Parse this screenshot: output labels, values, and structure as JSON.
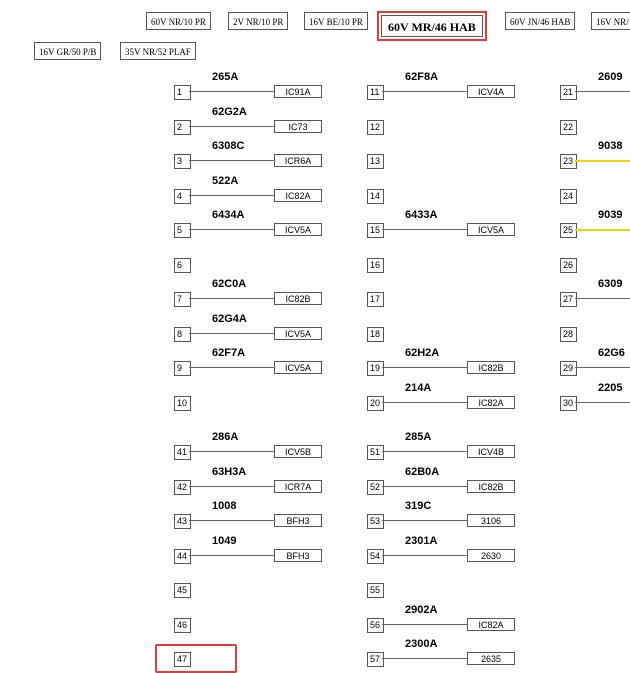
{
  "tabs": [
    {
      "label": "60V NR/10 PR",
      "active": false
    },
    {
      "label": "2V NR/10 PR",
      "active": false
    },
    {
      "label": "16V BE/10 PR",
      "active": false
    },
    {
      "label": "60V MR/46 HAB",
      "active": true
    },
    {
      "label": "60V JN/46 HAB",
      "active": false
    },
    {
      "label": "16V NR/",
      "active": false
    },
    {
      "label": "16V GR/50 P/B",
      "active": false
    },
    {
      "label": "35V NR/52 PLAF",
      "active": false
    }
  ],
  "colors": {
    "accent": "#e53935",
    "yellow_wire": "#f2d500"
  },
  "columns": [
    {
      "id": "col1",
      "slots": [
        {
          "n": "1",
          "circuit": "265A",
          "dest": "IC91A"
        },
        {
          "n": "2",
          "circuit": "62G2A",
          "dest": "IC73"
        },
        {
          "n": "3",
          "circuit": "6308C",
          "dest": "ICR6A"
        },
        {
          "n": "4",
          "circuit": "522A",
          "dest": "IC82A"
        },
        {
          "n": "5",
          "circuit": "6434A",
          "dest": "ICV5A"
        },
        {
          "n": "6",
          "circuit": "",
          "dest": ""
        },
        {
          "n": "7",
          "circuit": "62C0A",
          "dest": "IC82B"
        },
        {
          "n": "8",
          "circuit": "62G4A",
          "dest": "ICV5A"
        },
        {
          "n": "9",
          "circuit": "62F7A",
          "dest": "ICV5A"
        },
        {
          "n": "10",
          "circuit": "",
          "dest": ""
        }
      ]
    },
    {
      "id": "col2",
      "slots": [
        {
          "n": "11",
          "circuit": "62F8A",
          "dest": "ICV4A"
        },
        {
          "n": "12",
          "circuit": "",
          "dest": ""
        },
        {
          "n": "13",
          "circuit": "",
          "dest": ""
        },
        {
          "n": "14",
          "circuit": "",
          "dest": ""
        },
        {
          "n": "15",
          "circuit": "6433A",
          "dest": "ICV5A"
        },
        {
          "n": "16",
          "circuit": "",
          "dest": ""
        },
        {
          "n": "17",
          "circuit": "",
          "dest": ""
        },
        {
          "n": "18",
          "circuit": "",
          "dest": ""
        },
        {
          "n": "19",
          "circuit": "62H2A",
          "dest": "IC82B"
        },
        {
          "n": "20",
          "circuit": "214A",
          "dest": "IC82A"
        }
      ]
    },
    {
      "id": "col3",
      "slots": [
        {
          "n": "21",
          "circuit": "2609",
          "dest": "",
          "wire": "grey"
        },
        {
          "n": "22",
          "circuit": "",
          "dest": ""
        },
        {
          "n": "23",
          "circuit": "9038",
          "dest": "",
          "wire": "yellow"
        },
        {
          "n": "24",
          "circuit": "",
          "dest": ""
        },
        {
          "n": "25",
          "circuit": "9039",
          "dest": "",
          "wire": "yellow"
        },
        {
          "n": "26",
          "circuit": "",
          "dest": ""
        },
        {
          "n": "27",
          "circuit": "6309",
          "dest": "",
          "wire": "grey"
        },
        {
          "n": "28",
          "circuit": "",
          "dest": ""
        },
        {
          "n": "29",
          "circuit": "62G6",
          "dest": "",
          "wire": "grey"
        },
        {
          "n": "30",
          "circuit": "2205",
          "dest": "",
          "wire": "grey"
        }
      ]
    },
    {
      "id": "col4",
      "slots": [
        {
          "n": "41",
          "circuit": "286A",
          "dest": "ICV5B"
        },
        {
          "n": "42",
          "circuit": "63H3A",
          "dest": "ICR7A"
        },
        {
          "n": "43",
          "circuit": "1008",
          "dest": "BFH3"
        },
        {
          "n": "44",
          "circuit": "1049",
          "dest": "BFH3"
        },
        {
          "n": "45",
          "circuit": "",
          "dest": ""
        },
        {
          "n": "46",
          "circuit": "",
          "dest": ""
        },
        {
          "n": "47",
          "circuit": "",
          "dest": "",
          "highlight": true
        }
      ]
    },
    {
      "id": "col5",
      "slots": [
        {
          "n": "51",
          "circuit": "285A",
          "dest": "ICV4B"
        },
        {
          "n": "52",
          "circuit": "62B0A",
          "dest": "IC82B"
        },
        {
          "n": "53",
          "circuit": "319C",
          "dest": "3106"
        },
        {
          "n": "54",
          "circuit": "2301A",
          "dest": "2630"
        },
        {
          "n": "55",
          "circuit": "",
          "dest": ""
        },
        {
          "n": "56",
          "circuit": "2902A",
          "dest": "IC82A"
        },
        {
          "n": "57",
          "circuit": "2300A",
          "dest": "2635"
        }
      ]
    }
  ]
}
